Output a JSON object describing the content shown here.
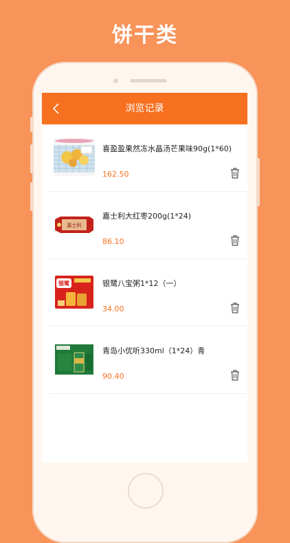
{
  "promo": {
    "title": "饼干类"
  },
  "nav": {
    "title": "浏览记录"
  },
  "colors": {
    "accent": "#F7701F",
    "background": "#F8935A"
  },
  "items": [
    {
      "name": "喜盈盈果然冻水晶汤芒果味90g(1*60)",
      "price": "162.50",
      "thumb": "jelly-product-image",
      "delete_icon": "trash-icon"
    },
    {
      "name": "嘉士利大红枣200g(1*24)",
      "price": "86.10",
      "thumb": "biscuit-pack-image",
      "delete_icon": "trash-icon"
    },
    {
      "name": "银鹭八宝粥1*12（一）",
      "price": "34.00",
      "thumb": "porridge-box-image",
      "delete_icon": "trash-icon"
    },
    {
      "name": "青岛小优听330ml（1*24）青",
      "price": "90.40",
      "thumb": "beer-case-image",
      "delete_icon": "trash-icon"
    }
  ]
}
